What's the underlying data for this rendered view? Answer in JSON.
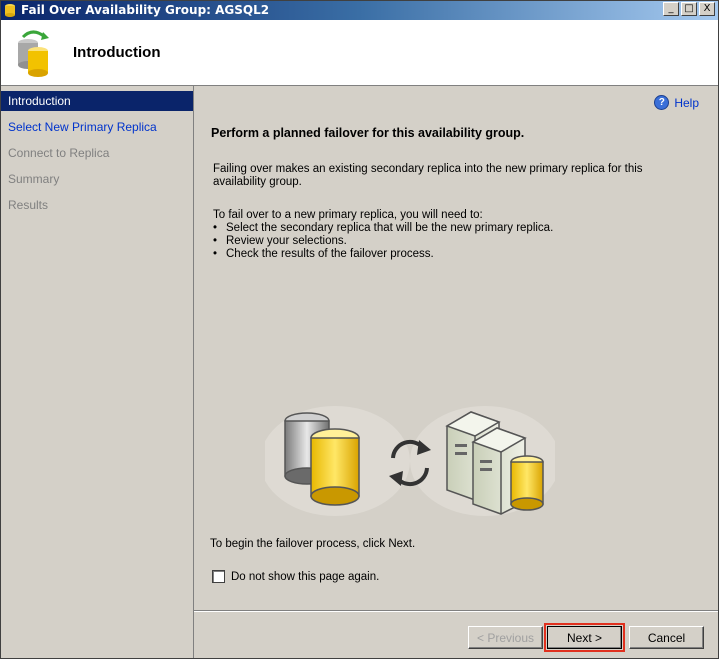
{
  "window": {
    "title": "Fail Over Availability Group: AGSQL2",
    "controls": {
      "minimize": "_",
      "maximize": "□",
      "close": "X"
    }
  },
  "header": {
    "title": "Introduction"
  },
  "nav": {
    "items": [
      {
        "label": "Introduction",
        "state": "active"
      },
      {
        "label": "Select New Primary Replica",
        "state": "link"
      },
      {
        "label": "Connect to Replica",
        "state": "disabled"
      },
      {
        "label": "Summary",
        "state": "disabled"
      },
      {
        "label": "Results",
        "state": "disabled"
      }
    ]
  },
  "content": {
    "help_label": "Help",
    "heading": "Perform a planned failover for this availability group.",
    "paragraph1": "Failing over makes an existing secondary replica into the new primary replica for this availability group.",
    "paragraph2_intro": "To fail over to a new primary replica, you will need to:",
    "bullets": [
      "Select the secondary replica that will be the new primary replica.",
      "Review your selections.",
      "Check the results of the failover process."
    ],
    "begin_text": "To begin the failover process, click Next.",
    "checkbox_label": "Do not show this page again.",
    "checkbox_checked": false
  },
  "footer": {
    "previous_label": "< Previous",
    "next_label": "Next >",
    "cancel_label": "Cancel"
  },
  "colors": {
    "selection": "#0a246a",
    "link": "#0033cc",
    "highlight": "#e0301e",
    "database": "#f2c200"
  }
}
